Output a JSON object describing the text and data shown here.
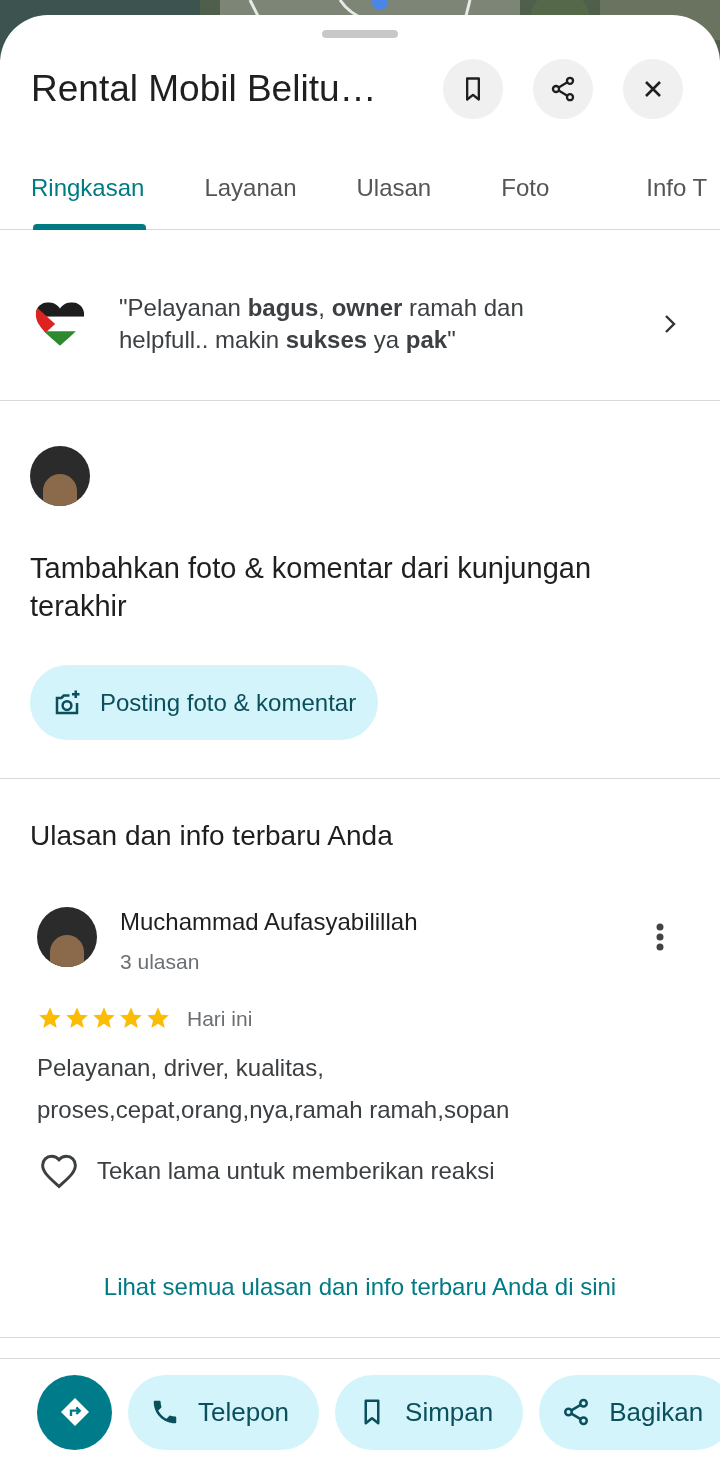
{
  "header": {
    "title": "Rental Mobil Belitu…",
    "actions": [
      {
        "kind": "bookmark"
      },
      {
        "kind": "share"
      },
      {
        "kind": "close"
      }
    ]
  },
  "tabs": [
    {
      "label": "Ringkasan",
      "selected": true
    },
    {
      "label": "Layanan",
      "selected": false
    },
    {
      "label": "Ulasan",
      "selected": false
    },
    {
      "label": "Foto",
      "selected": false
    },
    {
      "label": "Info T",
      "selected": false
    }
  ],
  "snippets": [
    {
      "kind": "flag",
      "text": "\"Pelayanan **bagus**, **owner** ramah dan helpfull.. makin **sukses** ya **pak**\"",
      "chevron": true
    }
  ],
  "prompt": {
    "title": "Tambahkan foto & komentar dari kunjungan terakhir",
    "button": "Posting foto & komentar"
  },
  "recent": {
    "heading": "Ulasan dan info terbaru Anda",
    "review": {
      "author": "Muchammad Aufasyabilillah",
      "count": "3 ulasan",
      "stars": 5,
      "time": "Hari ini",
      "text": "Pelayanan, driver, kualitas, proses,cepat,orang,nya,ramah ramah,sopan",
      "reaction": "Tekan lama untuk memberikan reaksi"
    },
    "link": "Lihat semua ulasan dan info terbaru Anda di sini"
  },
  "action_bar": [
    {
      "kind": "directions"
    },
    {
      "kind": "phone",
      "label": "Telepon"
    },
    {
      "kind": "save",
      "label": "Simpan"
    },
    {
      "kind": "share",
      "label": "Bagikan"
    }
  ]
}
